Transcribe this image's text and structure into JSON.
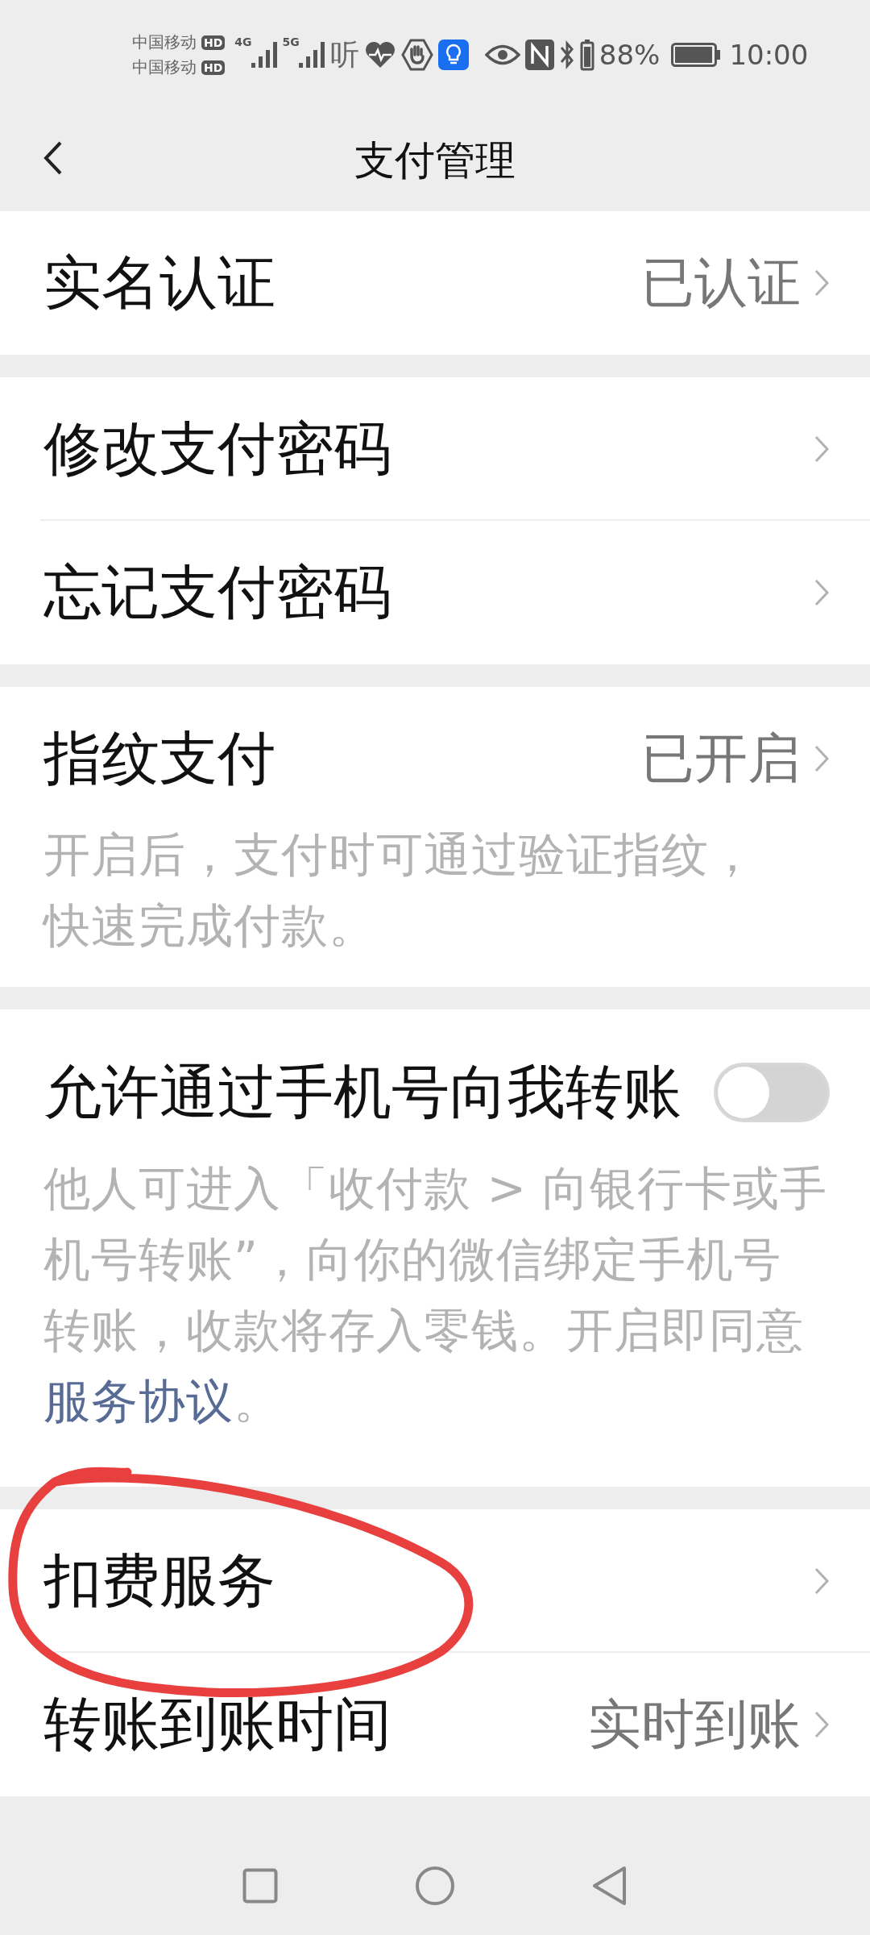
{
  "status_bar": {
    "carriers": [
      {
        "name": "中国移动",
        "badge": "HD"
      },
      {
        "name": "中国移动",
        "badge": "HD"
      }
    ],
    "network_labels": [
      "4G",
      "5G"
    ],
    "sound_glyph": "听",
    "battery_percent": "88%",
    "time": "10:00"
  },
  "header": {
    "title": "支付管理"
  },
  "sections": [
    {
      "rows": [
        {
          "kind": "link",
          "label": "实名认证",
          "value": "已认证"
        }
      ]
    },
    {
      "rows": [
        {
          "kind": "link",
          "label": "修改支付密码"
        },
        {
          "kind": "link",
          "label": "忘记支付密码"
        }
      ]
    },
    {
      "rows": [
        {
          "kind": "link",
          "label": "指纹支付",
          "value": "已开启",
          "description": {
            "text": "开启后，支付时可通过验证指纹，快速完成付款。"
          }
        }
      ]
    },
    {
      "rows": [
        {
          "kind": "toggle",
          "label": "允许通过手机号向我转账",
          "on": false,
          "description": {
            "text": "他人可进入「收付款 > 向银行卡或手机号转账”，向你的微信绑定手机号转账，收款将存入零钱。开启即同意",
            "link": "服务协议",
            "after": "。"
          }
        }
      ]
    },
    {
      "rows": [
        {
          "kind": "link",
          "label": "扣费服务"
        },
        {
          "kind": "link",
          "label": "转账到账时间",
          "value": "实时到账"
        }
      ]
    }
  ],
  "annotation": {
    "kind": "freehand-ellipse"
  }
}
